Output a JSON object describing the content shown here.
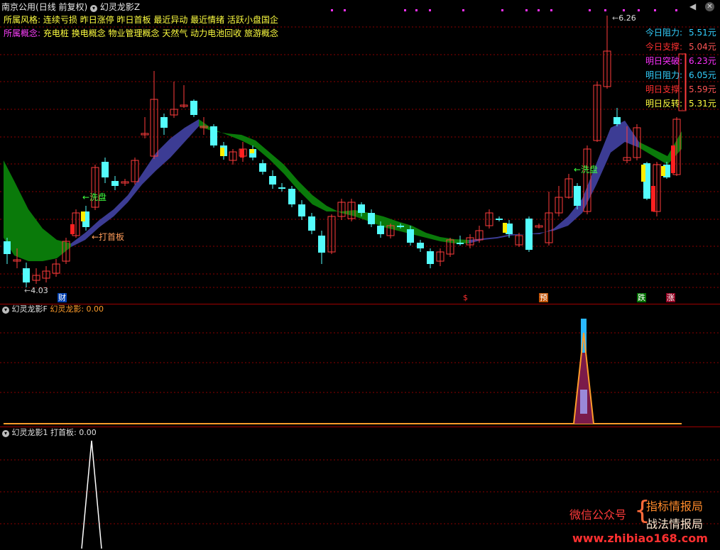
{
  "window": {
    "stock": "南京公用",
    "period": "(日线 前复权)",
    "indicator": "幻灵龙影Z",
    "settings_icon": "gear-icon",
    "close_icon": "close-icon"
  },
  "info": {
    "style_label": "所属风格:",
    "style_items": "连续亏损 昨日涨停 昨日首板 最近异动 最近情绪 活跃小盘国企",
    "concept_label": "所属概念:",
    "concept_items": "充电桩 换电概念 物业管理概念 天然气 动力电池回收 旅游概念"
  },
  "levels": [
    {
      "label": "今日阻力:",
      "value": "5.51",
      "unit": "元",
      "label_color": "#33d0ff",
      "value_color": "#33d0ff"
    },
    {
      "label": "今日支撑:",
      "value": "5.04",
      "unit": "元",
      "label_color": "#ff3030",
      "value_color": "#ff5555"
    },
    {
      "label": "明日突破:",
      "value": "6.23",
      "unit": "元",
      "label_color": "#ff30ff",
      "value_color": "#ff30ff"
    },
    {
      "label": "明日阻力:",
      "value": "6.05",
      "unit": "元",
      "label_color": "#33d0ff",
      "value_color": "#33d0ff"
    },
    {
      "label": "明日支撑:",
      "value": "5.59",
      "unit": "元",
      "label_color": "#ff3030",
      "value_color": "#ff5555"
    },
    {
      "label": "明日反转:",
      "value": "5.31",
      "unit": "元",
      "label_color": "#ffff40",
      "value_color": "#ffff40"
    }
  ],
  "annotations": {
    "high_label": "6.26",
    "low_label": "4.03",
    "wash1": "←洗盘",
    "wash2": "←洗盘",
    "first_board": "←打首板"
  },
  "markers": {
    "cai": "财",
    "dollar": "$",
    "yu": "预",
    "die": "跌",
    "zhang": "涨"
  },
  "panel2": {
    "title": "幻灵龙影F",
    "series": "幻灵龙影:",
    "value": "0.00"
  },
  "panel3": {
    "title": "幻灵龙影1",
    "series": "打首板:",
    "value": "0.00"
  },
  "watermark": {
    "left": "微信公众号",
    "right1": "指标情报局",
    "right2": "战法情报局",
    "url": "www.zhibiao168.com"
  },
  "colors": {
    "up": "#ff3c3c",
    "down": "#54fcfc",
    "band_green": "#0a7a0a",
    "band_blue": "#3c3c94",
    "grid": "#8b0000",
    "orange": "#ff9c2a"
  }
}
